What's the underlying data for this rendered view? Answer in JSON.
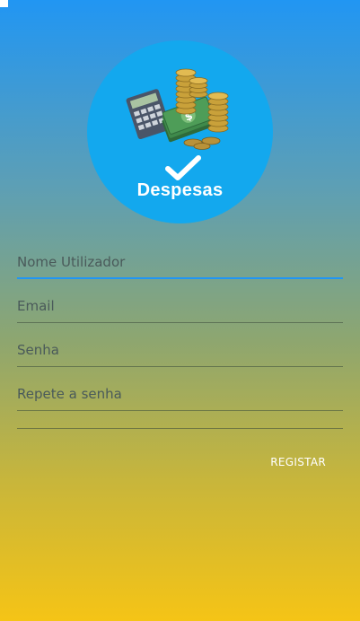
{
  "logo": {
    "text": "Despesas"
  },
  "form": {
    "username_placeholder": "Nome Utilizador",
    "email_placeholder": "Email",
    "password_placeholder": "Senha",
    "repeat_password_placeholder": "Repete a senha"
  },
  "actions": {
    "register_label": "REGISTAR"
  },
  "colors": {
    "gradient_top": "#2196F3",
    "gradient_bottom": "#F5C416",
    "logo_circle": "#13A8EE",
    "focus_underline": "#2196F3"
  },
  "icons": {
    "logo": "money-calculator-coins-icon",
    "check": "checkmark-icon"
  }
}
